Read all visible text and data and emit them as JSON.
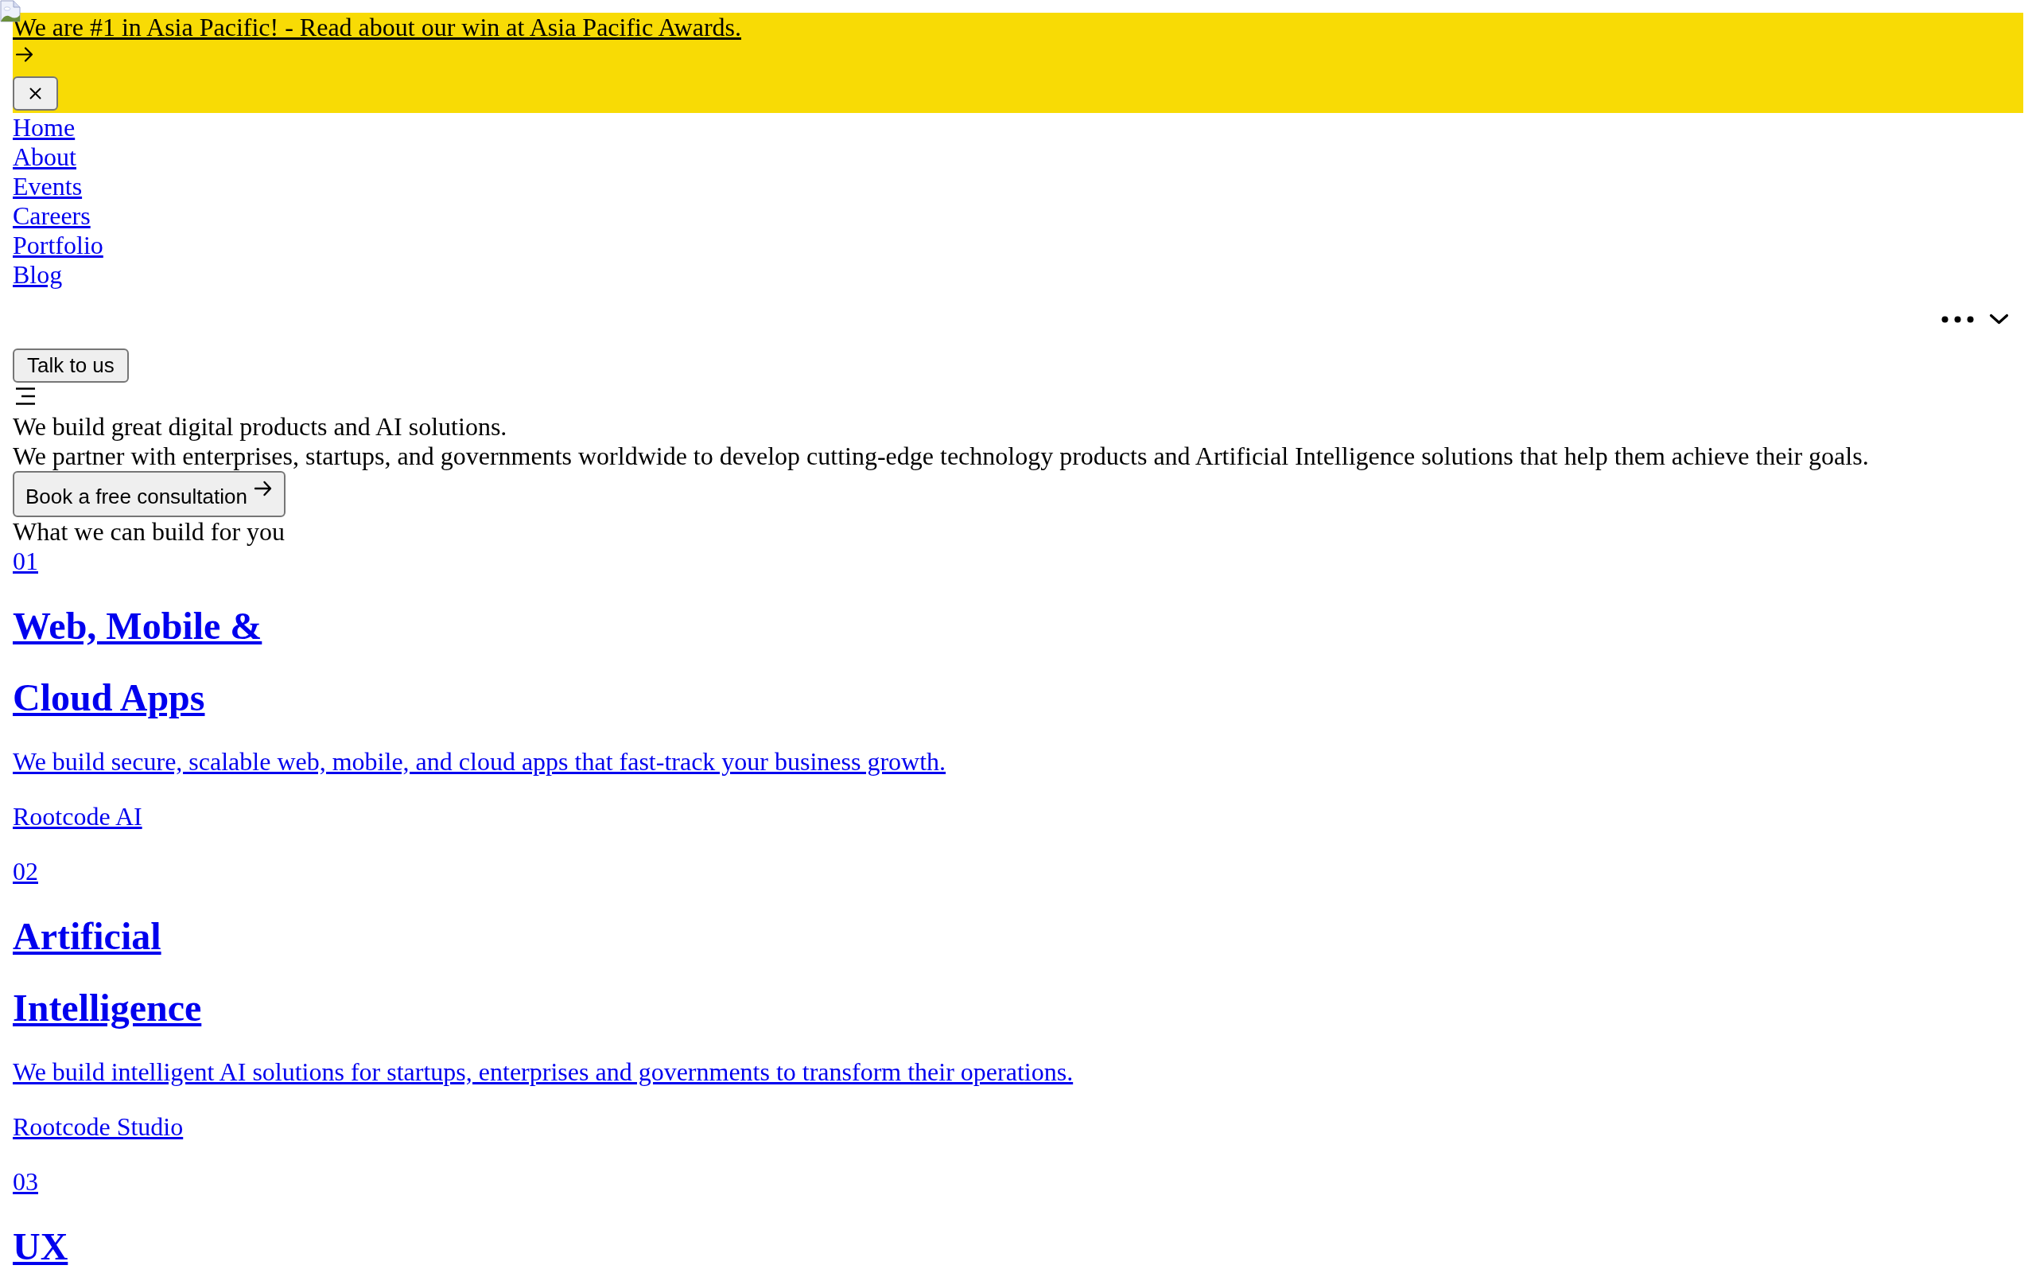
{
  "announcement": {
    "link": "We are #1 in Asia Pacific! - Read about our win at Asia Pacific Awards."
  },
  "nav": {
    "links": [
      "Home",
      "About",
      "Events",
      "Careers",
      "Portfolio",
      "Blog"
    ]
  },
  "header": {
    "contact_button": "Talk to us"
  },
  "hero": {
    "title": "We build great digital products and AI solutions.",
    "subtitle": "We partner with enterprises, startups, and governments worldwide to develop cutting-edge technology products and Artificial Intelligence solutions that help them achieve their goals.",
    "cta_button": "Book a free consultation"
  },
  "services": {
    "heading": "What we can build for you",
    "items": [
      {
        "number": "01",
        "title_lines": [
          "Web, Mobile &",
          "Cloud Apps"
        ],
        "description": "We build secure, scalable web, mobile, and cloud apps that fast-track your business growth.",
        "footer_link": "Rootcode AI"
      },
      {
        "number": "02",
        "title_lines": [
          "Artificial",
          "Intelligence"
        ],
        "description": "We build intelligent AI solutions for startups, enterprises and governments to transform their operations.",
        "footer_link": "Rootcode Studio"
      },
      {
        "number": "03",
        "title_lines": [
          "UX"
        ]
      }
    ]
  }
}
